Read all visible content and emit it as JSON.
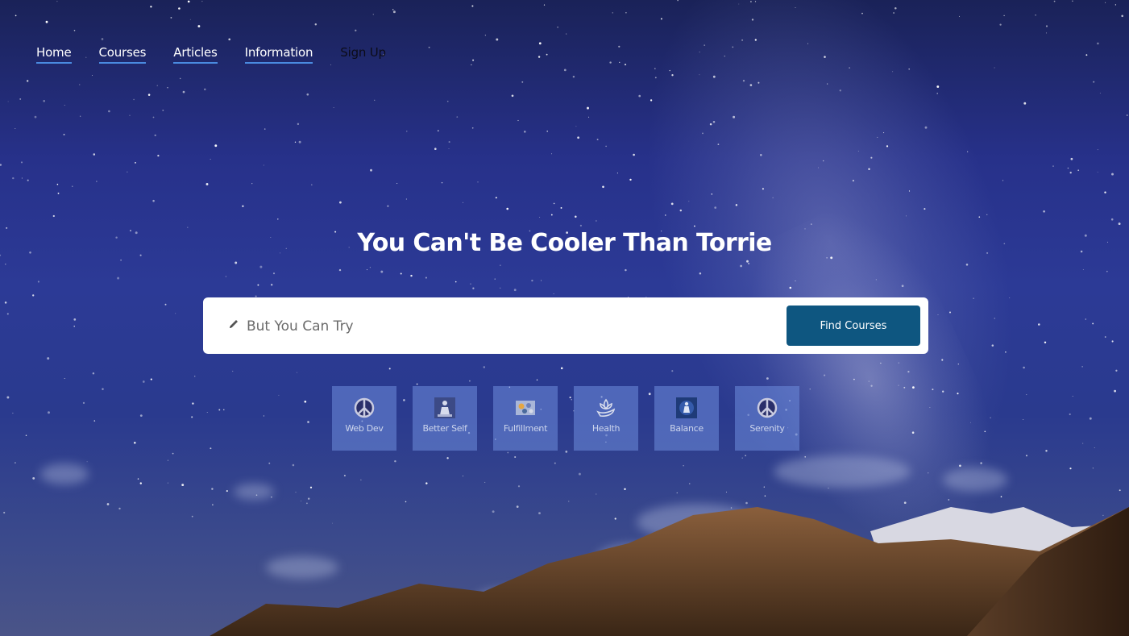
{
  "nav": {
    "items": [
      {
        "label": "Home"
      },
      {
        "label": "Courses"
      },
      {
        "label": "Articles"
      },
      {
        "label": "Information"
      },
      {
        "label": "Sign Up"
      }
    ]
  },
  "hero": {
    "title": "You Can't Be Cooler Than Torrie"
  },
  "search": {
    "placeholder": "But You Can Try",
    "icon": "pencil-icon",
    "button_label": "Find Courses"
  },
  "categories": [
    {
      "label": "Web Dev",
      "icon": "peace-icon"
    },
    {
      "label": "Better Self",
      "icon": "meditation-icon"
    },
    {
      "label": "Fulfillment",
      "icon": "stones-icon"
    },
    {
      "label": "Health",
      "icon": "lotus-hand-icon"
    },
    {
      "label": "Balance",
      "icon": "meditation-glow-icon"
    },
    {
      "label": "Serenity",
      "icon": "peace-icon"
    }
  ],
  "colors": {
    "accent_underline": "#4a8ae0",
    "button": "#0e5680",
    "sky": "#2c3a96"
  }
}
